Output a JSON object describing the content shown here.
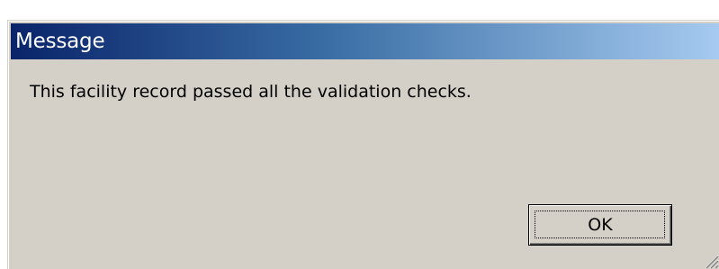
{
  "dialog": {
    "title": "Message",
    "message": "This facility record passed all the validation checks.",
    "ok_label": "OK",
    "icons": {
      "resize_grip": "resize-grip-icon"
    },
    "colors": {
      "title_start": "#0a246a",
      "title_end": "#a6caf0",
      "body": "#d4d0c8"
    }
  }
}
